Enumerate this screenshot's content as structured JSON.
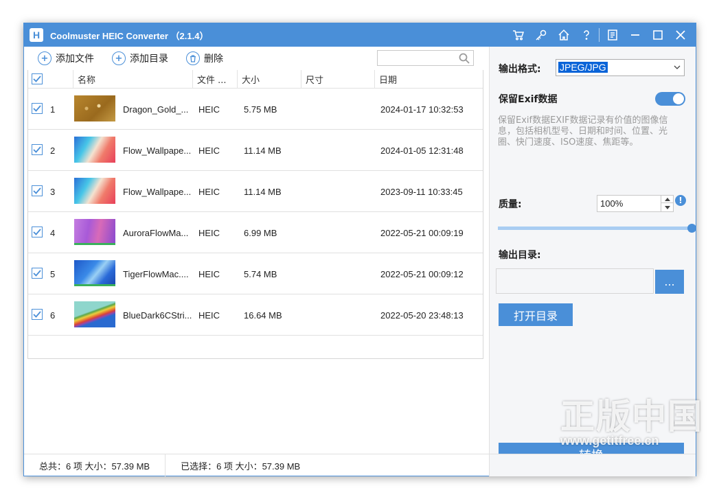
{
  "window": {
    "title": "Coolmuster HEIC Converter （2.1.4）",
    "logo_letter": "H",
    "title_icons": [
      "cart-icon",
      "key-icon",
      "home-icon",
      "help-icon",
      "feedback-icon",
      "minimize-icon",
      "maximize-icon",
      "close-icon"
    ]
  },
  "toolbar": {
    "add_file": "添加文件",
    "add_folder": "添加目录",
    "delete": "删除",
    "search_placeholder": ""
  },
  "table": {
    "headers": [
      "名称",
      "文件 ...",
      "大小",
      "尺寸",
      "日期"
    ],
    "rows": [
      {
        "index": "1",
        "name": "Dragon_Gold_...",
        "type": "HEIC",
        "size": "5.75 MB",
        "dimension": "",
        "date": "2024-01-17 10:32:53",
        "checked": true
      },
      {
        "index": "2",
        "name": "Flow_Wallpape...",
        "type": "HEIC",
        "size": "11.14 MB",
        "dimension": "",
        "date": "2024-01-05 12:31:48",
        "checked": true
      },
      {
        "index": "3",
        "name": "Flow_Wallpape...",
        "type": "HEIC",
        "size": "11.14 MB",
        "dimension": "",
        "date": "2023-09-11 10:33:45",
        "checked": true
      },
      {
        "index": "4",
        "name": "AuroraFlowMa...",
        "type": "HEIC",
        "size": "6.99 MB",
        "dimension": "",
        "date": "2022-05-21 00:09:19",
        "checked": true
      },
      {
        "index": "5",
        "name": "TigerFlowMac....",
        "type": "HEIC",
        "size": "5.74 MB",
        "dimension": "",
        "date": "2022-05-21 00:09:12",
        "checked": true
      },
      {
        "index": "6",
        "name": "BlueDark6CStri...",
        "type": "HEIC",
        "size": "16.64 MB",
        "dimension": "",
        "date": "2022-05-20 23:48:13",
        "checked": true
      }
    ]
  },
  "settings": {
    "output_format_label": "输出格式:",
    "output_format_value": "JPEG/JPG",
    "exif_label": "保留Exif数据",
    "exif_enabled": true,
    "exif_desc": "保留Exif数据EXIF数据记录有价值的图像信息，包括相机型号、日期和时间、位置、光圈、快门速度、ISO速度、焦距等。",
    "quality_label": "质量:",
    "quality_value": "100%",
    "quality_level": 1.0,
    "output_dir_label": "输出目录:",
    "output_dir_value": "",
    "browse_label": "...",
    "open_dir_label": "打开目录",
    "convert_label": "转换"
  },
  "status": {
    "total": "总共：6 项 大小：57.39 MB",
    "selected": "已选择：6 项 大小：57.39 MB"
  },
  "watermark": {
    "big": "正版中国",
    "small": "www.getitfree.cn"
  },
  "colors": {
    "accent": "#4a8fd8",
    "slider_track": "#a9cdf2"
  }
}
